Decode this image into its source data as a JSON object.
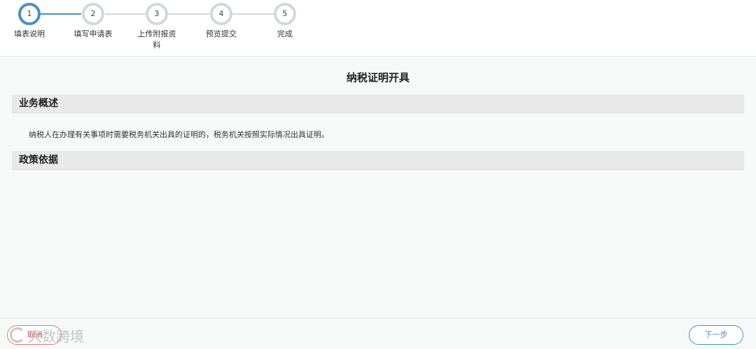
{
  "stepper": {
    "steps": [
      {
        "number": "1",
        "label": "填表说明",
        "current": true
      },
      {
        "number": "2",
        "label": "填写申请表",
        "current": false
      },
      {
        "number": "3",
        "label": "上传附报资料",
        "current": false
      },
      {
        "number": "4",
        "label": "预览提交",
        "current": false
      },
      {
        "number": "5",
        "label": "完成",
        "current": false
      }
    ]
  },
  "main": {
    "title": "纳税证明开具",
    "sections": [
      {
        "heading": "业务概述",
        "text": "纳税人在办理有关事项时需要税务机关出具的证明的，税务机关按照实际情况出具证明。"
      },
      {
        "heading": "政策依据",
        "text": ""
      }
    ]
  },
  "footer": {
    "cancel_label": "取消",
    "next_label": "下一步"
  },
  "watermark": {
    "text": "大数跨境"
  },
  "colors": {
    "accent": "#4a8fc7",
    "cancel": "#d9534f",
    "section_bg": "#e9e9e9",
    "content_bg": "#f7f9f9"
  }
}
